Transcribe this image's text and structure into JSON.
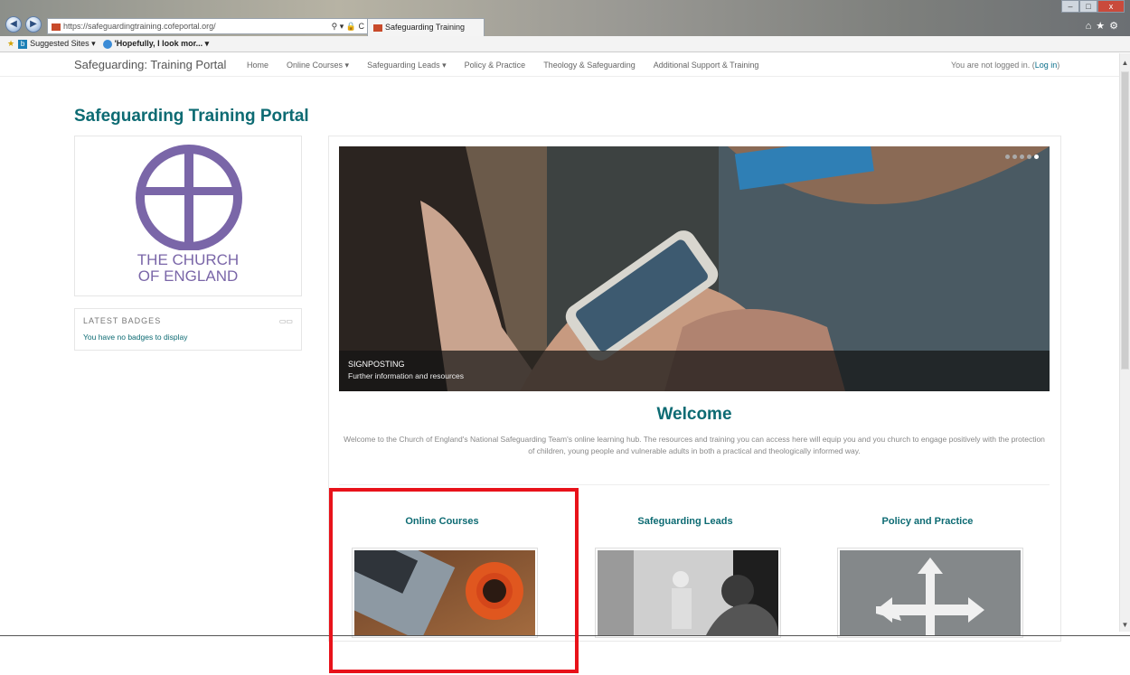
{
  "browser": {
    "address": "https://safeguardingtraining.cofeportal.org/",
    "address_tools": "⚲ ▾ 🔒 C",
    "tab_title": "Safeguarding Training Portal",
    "tab_close": "×",
    "favorites": {
      "suggested": "Suggested Sites ▾",
      "item": "'Hopefully, I look mor... ▾"
    }
  },
  "site": {
    "brand": "Safeguarding: Training Portal",
    "menu": [
      "Home",
      "Online Courses ▾",
      "Safeguarding Leads ▾",
      "Policy & Practice",
      "Theology & Safeguarding",
      "Additional Support & Training"
    ],
    "login_prefix": "You are not logged in. (",
    "login_link": "Log in",
    "login_suffix": ")"
  },
  "page": {
    "title": "Safeguarding Training Portal",
    "logo_line1": "THE CHURCH",
    "logo_line2": "OF ENGLAND",
    "badges_header": "LATEST BADGES",
    "badges_message": "You have no badges to display",
    "hero_caption_title": "SIGNPOSTING",
    "hero_caption_sub": "Further information and resources",
    "welcome_title": "Welcome",
    "welcome_text": "Welcome to the Church of England's National Safeguarding Team's online learning hub. The resources and training you can access here will equip you and you church to engage positively with the protection of children, young people and vulnerable adults in both a practical and theologically informed way.",
    "columns": [
      {
        "title": "Online Courses"
      },
      {
        "title": "Safeguarding Leads"
      },
      {
        "title": "Policy and Practice"
      }
    ]
  },
  "colors": {
    "accent_teal": "#0d6b73",
    "logo_purple": "#7a66a8",
    "highlight_red": "#e8121a"
  },
  "icons": [
    "back-icon",
    "forward-icon",
    "favorites-star-icon",
    "home-icon",
    "settings-gear-icon"
  ]
}
